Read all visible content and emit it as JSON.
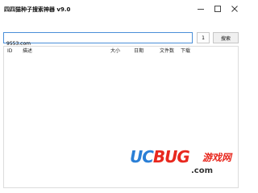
{
  "window": {
    "title": "四四猫种子搜索神器 v9.0",
    "controls": {
      "minimize": "minimize-icon",
      "maximize": "maximize-icon",
      "close": "close-icon"
    }
  },
  "toolbar": {
    "search_value": "9553.com",
    "page_number": "1",
    "search_label": "搜索"
  },
  "results": {
    "columns": [
      "ID",
      "描述",
      "大小",
      "日期",
      "文件数",
      "下载"
    ],
    "rows": []
  },
  "watermark": {
    "logo_uc": "UC",
    "logo_bug": "BUG",
    "logo_cn": "游戏网",
    "domain": ".com"
  },
  "colors": {
    "input_border": "#4a8fd8",
    "watermark_blue": "#2a7fd6",
    "watermark_red": "#e8281e"
  }
}
